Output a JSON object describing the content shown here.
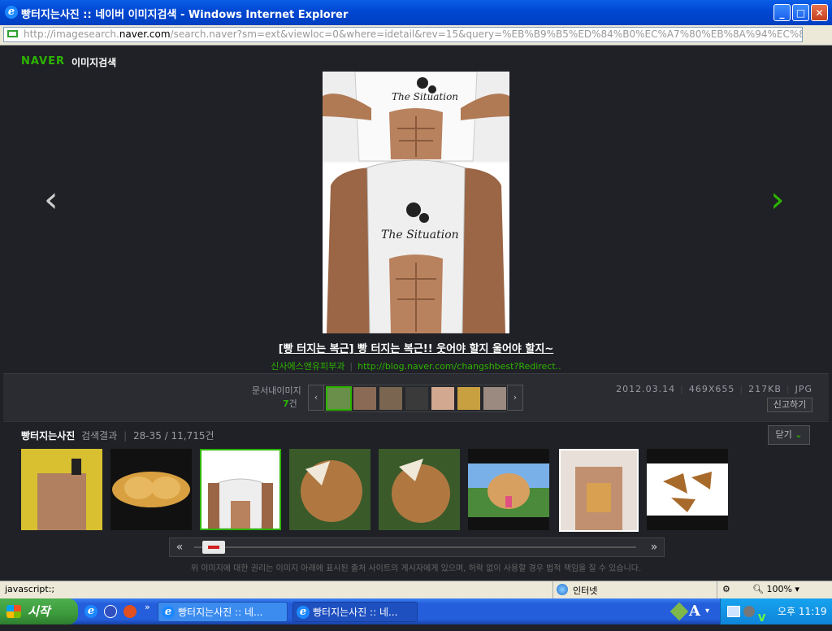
{
  "window": {
    "title": "빵터지는사진 :: 네이버 이미지검색 - Windows Internet Explorer",
    "icon": "ie-icon",
    "address": {
      "prefix": "http://imagesearch.",
      "domain": "naver.com",
      "rest": "/search.naver?sm=ext&viewloc=0&where=idetail&rev=15&query=%EB%B9%B5%ED%84%B0%EC%A7%80%EB%8A%94%EC%82%AC%EC%A7"
    }
  },
  "header": {
    "brand": "NAVER",
    "section": "이미지검색"
  },
  "viewer": {
    "prev": "‹",
    "next": "›",
    "caption": "[빵 터지는 복근] 빵 터지는 복근!! 웃어야 할지 울어야 할지~",
    "source_name": "신사에스앤유피부과",
    "source_url": "http://blog.naver.com/changshbest?Redirect..",
    "shirt_text": "The Situation"
  },
  "info": {
    "doc_images_label": "문서내이미지",
    "doc_images_count": "7",
    "doc_images_unit": "건",
    "date": "2012.03.14",
    "dimensions": "469X655",
    "filesize": "217KB",
    "format": "JPG",
    "report": "신고하기",
    "left": "‹",
    "right": "›"
  },
  "results": {
    "query": "빵터지는사진",
    "label": "검색결과",
    "range": "28-35 / 11,715건",
    "close": "닫기",
    "close_icon": "chevron-down-icon"
  },
  "scroll": {
    "left": "«",
    "right": "»"
  },
  "notice": "위 이미지에 대한 권리는 이미지 아래에 표시된 출처 사이트의 게시자에게 있으며, 허락 없이 사용할 경우 법적 책임을 질 수 있습니다.",
  "statusbar": {
    "text": "javascript:;",
    "zone": "인터넷",
    "zoom": "100%"
  },
  "taskbar": {
    "start": "시작",
    "tasks": [
      "빵터지는사진 :: 네...",
      "빵터지는사진 :: 네..."
    ],
    "clock": "오후 11:19"
  },
  "colors": {
    "naver_green": "#2db400",
    "page_bg": "#1f2126",
    "selected_border": "#2db400"
  }
}
